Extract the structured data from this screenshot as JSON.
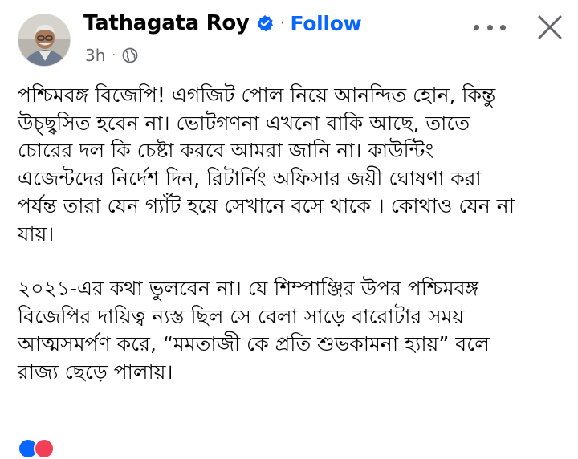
{
  "post": {
    "author": "Tathagata Roy",
    "follow_label": "Follow",
    "timestamp": "3h",
    "separator": "·",
    "paragraphs": [
      {
        "lines": [
          "পশ্চিমবঙ্গ বিজেপি! এগজিট পোল নিয়ে আনন্দিত হোন, কিন্তু",
          "উচ্ছ্বসিত হবেন  না। ভোটগণনা এখনো বাকি আছে, তাতে",
          "চোরের দল কি চেষ্টা করবে আমরা জানি না। কাউন্টিং",
          "এজেন্টদের নির্দেশ দিন, রিটার্নিং অফিসার জয়ী ঘোষণা করা",
          "পর্যন্ত তারা যেন গ্যাঁট হয়ে সেখানে বসে থাকে । কোথাও যেন না",
          "যায়।"
        ]
      },
      {
        "lines": [
          "২০২১-এর কথা ভুলবেন না। যে শিম্পাঞ্জির উপর পশ্চিমবঙ্গ",
          "বিজেপির দায়িত্ব ন্যস্ত ছিল সে বেলা সাড়ে বারোটার সময়",
          "আত্মসমর্পণ করে, “মমতাজী কে প্রতি শুভকামনা হ্যায়” বলে",
          "রাজ্য ছেড়ে পালায়।"
        ]
      }
    ]
  },
  "icons": {
    "verified": "verified-badge-icon",
    "audience": "globe-icon",
    "more": "more-options-icon",
    "close": "close-icon"
  },
  "colors": {
    "accent": "#0866ff",
    "text": "#050505",
    "secondary": "#65676b"
  }
}
